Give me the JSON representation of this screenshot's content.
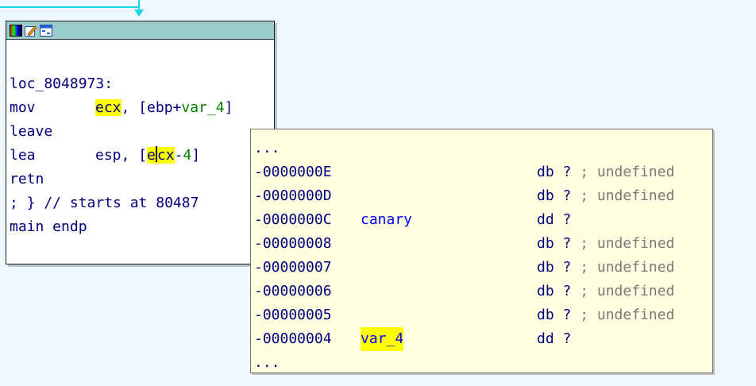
{
  "graph": {
    "edge_color": "#18d4e4",
    "node": {
      "titlebar_icons": [
        "color-palette-icon",
        "edit-node-icon",
        "graph-view-icon"
      ],
      "label": "loc_8048973:",
      "lines": [
        {
          "mnem": "mov",
          "reg": "ecx",
          "sep": ", [ebp+",
          "var": "var_4",
          "close": "]"
        },
        {
          "mnem": "leave"
        },
        {
          "mnem": "lea",
          "reg1": "esp",
          "bracket": ", [",
          "reg_pre": "e",
          "reg_post": "cx",
          "minus": "-",
          "num": "4",
          "close": "]"
        },
        {
          "mnem": "retn"
        }
      ],
      "comment": "; } // starts at 80487",
      "endp": "main endp"
    }
  },
  "hint": {
    "ellipsis_top": "...",
    "ellipsis_bottom": "...",
    "rows": [
      {
        "offset": "-0000000E",
        "name": "",
        "type": "db ?",
        "comment": " ; undefined"
      },
      {
        "offset": "-0000000D",
        "name": "",
        "type": "db ?",
        "comment": " ; undefined"
      },
      {
        "offset": "-0000000C",
        "name": "canary",
        "type": "dd ?",
        "comment": ""
      },
      {
        "offset": "-00000008",
        "name": "",
        "type": "db ?",
        "comment": " ; undefined"
      },
      {
        "offset": "-00000007",
        "name": "",
        "type": "db ?",
        "comment": " ; undefined"
      },
      {
        "offset": "-00000006",
        "name": "",
        "type": "db ?",
        "comment": " ; undefined"
      },
      {
        "offset": "-00000005",
        "name": "",
        "type": "db ?",
        "comment": " ; undefined"
      },
      {
        "offset": "-00000004",
        "name": "var_4",
        "type": "dd ?",
        "comment": ""
      }
    ]
  },
  "colors": {
    "highlight": "#ffff00",
    "code": "#00007f",
    "number": "#008000",
    "comment": "#7a7a7a",
    "tooltip_bg": "#ffffe1"
  }
}
